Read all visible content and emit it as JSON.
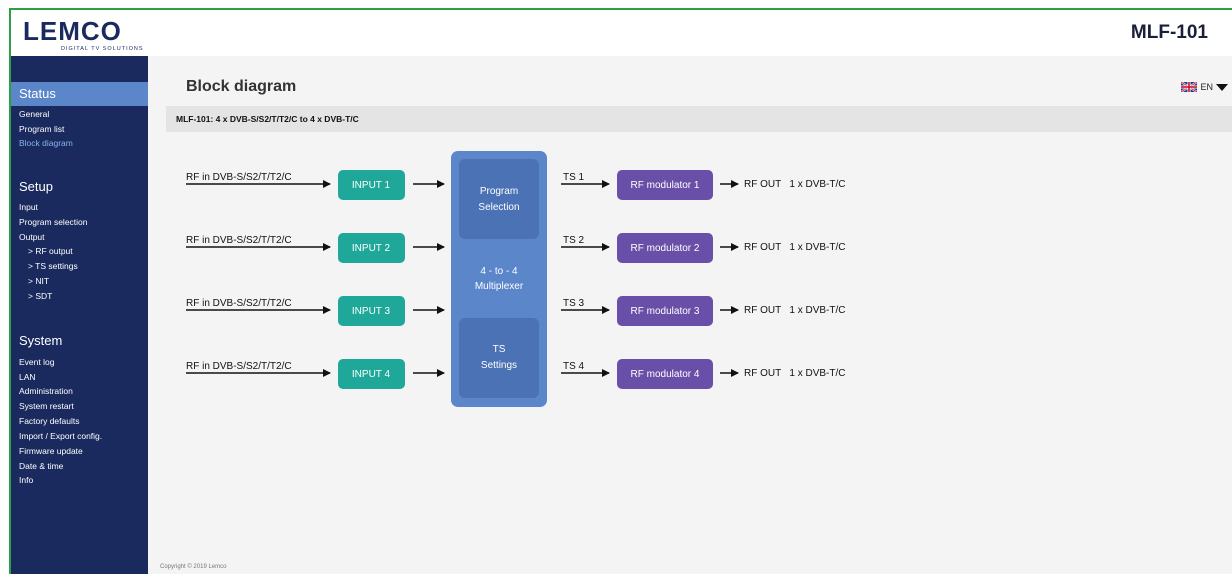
{
  "header": {
    "logo_text": "LEMCO",
    "logo_tagline": "DIGITAL TV SOLUTIONS",
    "model": "MLF-101"
  },
  "sidebar": {
    "sections": [
      {
        "title": "Status",
        "active": true,
        "items": [
          {
            "label": "General"
          },
          {
            "label": "Program list"
          },
          {
            "label": "Block diagram",
            "current": true
          }
        ]
      },
      {
        "title": "Setup",
        "items": [
          {
            "label": "Input"
          },
          {
            "label": "Program selection"
          },
          {
            "label": "Output"
          },
          {
            "label": "> RF output",
            "sub": true
          },
          {
            "label": "> TS settings",
            "sub": true
          },
          {
            "label": "> NIT",
            "sub": true
          },
          {
            "label": "> SDT",
            "sub": true
          }
        ]
      },
      {
        "title": "System",
        "items": [
          {
            "label": "Event log"
          },
          {
            "label": "LAN"
          },
          {
            "label": "Administration"
          },
          {
            "label": "System restart"
          },
          {
            "label": "Factory defaults"
          },
          {
            "label": "Import / Export config."
          },
          {
            "label": "Firmware update"
          },
          {
            "label": "Date & time"
          },
          {
            "label": "Info"
          }
        ]
      }
    ]
  },
  "main": {
    "title": "Block diagram",
    "language": "EN",
    "subtitle": "MLF-101:   4 x DVB-S/S2/T/T2/C to 4 x DVB-T/C",
    "copyright": "Copyright © 2019 Lemco"
  },
  "diagram": {
    "rows": [
      {
        "rf_in": "RF in DVB-S/S2/T/T2/C",
        "input": "INPUT 1",
        "ts": "TS 1",
        "modulator": "RF modulator 1",
        "rf_out": "RF OUT   1 x DVB-T/C"
      },
      {
        "rf_in": "RF in DVB-S/S2/T/T2/C",
        "input": "INPUT 2",
        "ts": "TS 2",
        "modulator": "RF modulator 2",
        "rf_out": "RF OUT   1 x DVB-T/C"
      },
      {
        "rf_in": "RF in DVB-S/S2/T/T2/C",
        "input": "INPUT 3",
        "ts": "TS 3",
        "modulator": "RF modulator 3",
        "rf_out": "RF OUT   1 x DVB-T/C"
      },
      {
        "rf_in": "RF in DVB-S/S2/T/T2/C",
        "input": "INPUT 4",
        "ts": "TS 4",
        "modulator": "RF modulator 4",
        "rf_out": "RF OUT   1 x DVB-T/C"
      }
    ],
    "mux_top_line1": "Program",
    "mux_top_line2": "Selection",
    "mux_mid_line1": "4 - to - 4",
    "mux_mid_line2": "Multiplexer",
    "mux_bot_line1": "TS",
    "mux_bot_line2": "Settings",
    "colors": {
      "input": "#1fa89a",
      "mux_outer": "#5b86c9",
      "mux_inner": "#4a72b4",
      "modulator": "#6a4fa8"
    }
  }
}
